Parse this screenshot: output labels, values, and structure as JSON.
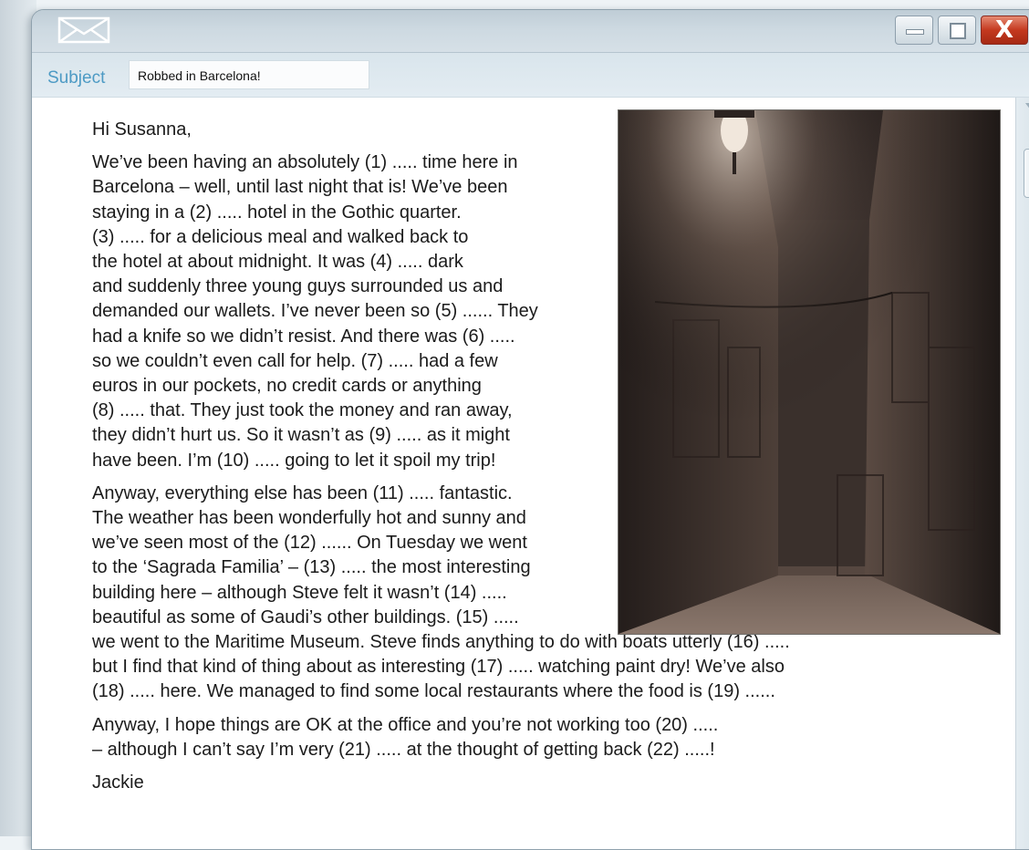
{
  "window": {
    "mail_icon": "envelope-icon",
    "controls": {
      "minimize_icon": "minimize-icon",
      "maximize_icon": "maximize-icon",
      "close_label": "X"
    }
  },
  "subject": {
    "label": "Subject",
    "value": "Robbed in Barcelona!"
  },
  "email": {
    "greeting": "Hi Susanna,",
    "paragraph1_lines": [
      "We’ve been having an absolutely (1) ..... time here in",
      "Barcelona – well, until last night that is! We’ve been",
      "staying in a (2) ..... hotel in the Gothic quarter.",
      "(3) ..... for a delicious meal and walked back to",
      "the hotel at about midnight. It was (4) ..... dark",
      "and suddenly three young guys surrounded us and",
      "demanded our wallets. I’ve never been so (5) ...... They",
      "had a knife so we didn’t resist. And there was (6) .....",
      "so we couldn’t even call for help. (7) ..... had a few",
      "euros in our pockets, no credit cards or anything",
      "(8) ..... that. They just took the money and ran away,",
      "they didn’t hurt us. So it wasn’t as (9) ..... as it might",
      "have been. I’m (10) ..... going to let it spoil my trip!"
    ],
    "paragraph2_lines": [
      "Anyway, everything else has been (11) ..... fantastic.",
      "The weather has been wonderfully hot and sunny and",
      "we’ve seen most of the (12) ...... On Tuesday we went",
      "to the ‘Sagrada Familia’ – (13) ..... the most interesting",
      "building here – although Steve felt it wasn’t (14) .....",
      "beautiful as some of Gaudi’s other buildings. (15) .....",
      "we went to the Maritime Museum. Steve finds anything to do with boats utterly (16) .....",
      "but I find that kind of thing about as interesting (17) ..... watching paint dry! We’ve also",
      "(18) ..... here. We managed to find some local restaurants where the food is (19) ......"
    ],
    "paragraph3_lines": [
      "Anyway, I hope things are OK at the office and you’re not working too (20) .....",
      "– although I can’t say I’m very (21) ..... at the thought of getting back (22) .....!"
    ],
    "signoff": "Jackie"
  },
  "photo": {
    "subject": "night-alley-photo"
  },
  "colors": {
    "subject_label": "#4d9ac4",
    "close_button": "#c4391f",
    "titlebar": "#c8d5de"
  }
}
